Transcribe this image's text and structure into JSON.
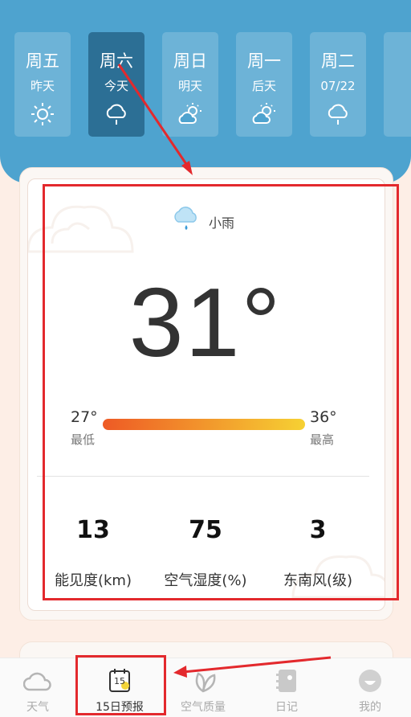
{
  "days": [
    {
      "name": "周五",
      "sub": "昨天",
      "icon": "sun-icon"
    },
    {
      "name": "周六",
      "sub": "今天",
      "icon": "rain-cloud-icon",
      "active": true
    },
    {
      "name": "周日",
      "sub": "明天",
      "icon": "partly-cloudy-icon"
    },
    {
      "name": "周一",
      "sub": "后天",
      "icon": "partly-cloudy-icon"
    },
    {
      "name": "周二",
      "sub": "07/22",
      "icon": "rain-cloud-icon"
    }
  ],
  "today": {
    "condition": "小雨",
    "temperature": "31°",
    "low": "27°",
    "low_label": "最低",
    "high": "36°",
    "high_label": "最高",
    "stats": [
      {
        "value": "13",
        "label": "能见度(km)"
      },
      {
        "value": "75",
        "label": "空气湿度(%)"
      },
      {
        "value": "3",
        "label": "东南风(级)"
      }
    ]
  },
  "nav": {
    "weather": "天气",
    "forecast": "15日预报",
    "forecast_badge": "15",
    "air": "空气质量",
    "diary": "日记",
    "mine": "我的"
  },
  "colors": {
    "banner": "#4ea3cf",
    "active_day": "#2c6f95",
    "annotation_red": "#e3292d",
    "range_start": "#ee5a25",
    "range_end": "#f6d133"
  }
}
